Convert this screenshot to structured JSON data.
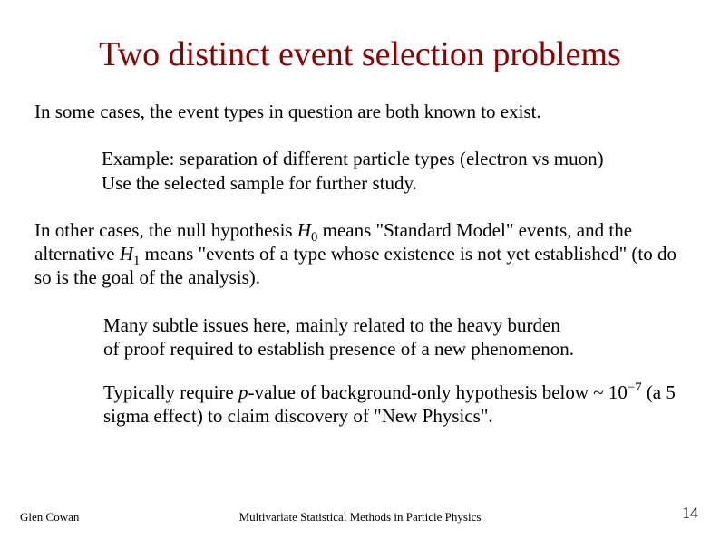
{
  "title": "Two distinct event selection problems",
  "para1": "In some cases, the event types in question are both known to exist.",
  "indent1_line1": "Example:  separation of different particle types (electron vs muon)",
  "indent1_line2": "Use the selected sample for further study.",
  "para2_pre": "In other cases, the null hypothesis ",
  "para2_H": "H",
  "para2_sub0": "0",
  "para2_mid": " means \"Standard Model\" events, and the alternative ",
  "para2_H1": "H",
  "para2_sub1": "1",
  "para2_post": " means \"events of a type whose existence is not yet established\" (to do so is the goal of the analysis).",
  "indent2_line1": "Many subtle issues here, mainly related to the heavy burden",
  "indent2_line2": "of proof required to establish presence of a new phenomenon.",
  "indent3_pre": "Typically require ",
  "indent3_p": "p",
  "indent3_mid": "-value of background-only hypothesis below ~ 10",
  "indent3_sup": "−7",
  "indent3_post": " (a 5 sigma effect) to claim discovery of \"New Physics\".",
  "footer_left": "Glen Cowan",
  "footer_center": "Multivariate Statistical Methods in Particle Physics",
  "footer_right": "14"
}
